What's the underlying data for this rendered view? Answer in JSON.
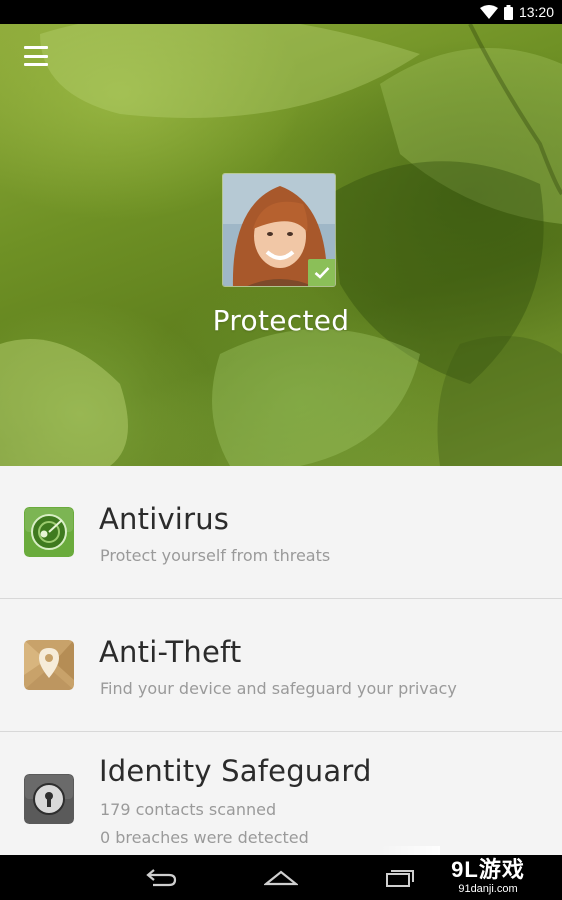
{
  "status_bar": {
    "time": "13:20",
    "icons": [
      "wifi-icon",
      "battery-icon"
    ]
  },
  "header": {
    "menu_icon": "hamburger-menu-icon",
    "protection_status": "Protected",
    "avatar_badge_icon": "check-icon"
  },
  "features": [
    {
      "icon": "antivirus-radar-icon",
      "title": "Antivirus",
      "subtitle": "Protect yourself from threats"
    },
    {
      "icon": "map-location-pin-icon",
      "title": "Anti-Theft",
      "subtitle": "Find your device and safeguard your privacy"
    },
    {
      "icon": "lock-keyhole-icon",
      "title": "Identity Safeguard",
      "subtitle": "179 contacts scanned",
      "subtitle2": "0 breaches were detected"
    }
  ],
  "nav_bar": {
    "buttons": [
      "back-icon",
      "home-icon",
      "recent-apps-icon"
    ]
  },
  "watermark": {
    "main": "9L游戏",
    "sub": "91danji.com"
  },
  "colors": {
    "hero_green": "#6f9125",
    "badge_green": "#8bbf58",
    "antivirus_green": "#6aab3c",
    "antitheft_tan": "#c8a26a",
    "identity_gray": "#5a5a5a"
  }
}
